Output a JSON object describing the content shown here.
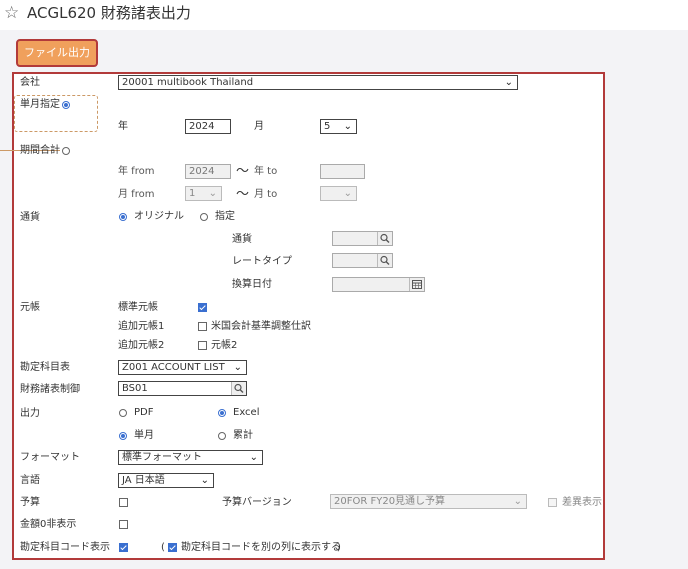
{
  "header": {
    "star_icon": "☆",
    "title": "ACGL620 財務諸表出力"
  },
  "toolbar": {
    "export_label": "ファイル出力"
  },
  "form": {
    "company_label": "会社",
    "company_value": "20001 multibook Thailand",
    "single_month_label": "単月指定",
    "year_label": "年",
    "year_value": "2024",
    "month_label": "月",
    "month_value": "5",
    "period_total_label": "期間合計",
    "year_from_label": "年 from",
    "year_from_value": "2024",
    "tilde": "～",
    "year_to_label": "年 to",
    "month_from_label": "月 from",
    "month_from_value": "1",
    "month_to_label": "月 to",
    "currency_label": "通貨",
    "currency_original": "オリジナル",
    "currency_specified": "指定",
    "currency_sub_label": "通貨",
    "rate_type_label": "レートタイプ",
    "conversion_date_label": "換算日付",
    "ledger_label": "元帳",
    "standard_ledger_label": "標準元帳",
    "additional_ledger1_label": "追加元帳1",
    "us_gaap_label": "米国会計基準調整仕訳",
    "additional_ledger2_label": "追加元帳2",
    "ledger2_label": "元帳2",
    "account_table_label": "勘定科目表",
    "account_table_value": "Z001 ACCOUNT LIST",
    "fs_control_label": "財務諸表制御",
    "fs_control_value": "BS01",
    "output_label": "出力",
    "pdf_label": "PDF",
    "excel_label": "Excel",
    "single_label": "単月",
    "cumulative_label": "累計",
    "format_label": "フォーマット",
    "format_value": "標準フォーマット",
    "language_label": "言語",
    "language_value": "JA 日本語",
    "budget_label": "予算",
    "budget_version_label": "予算バージョン",
    "budget_version_value": "20FOR FY20見通し予算",
    "variance_label": "差異表示",
    "zero_hide_label": "金額0非表示",
    "account_code_label": "勘定科目コード表示",
    "account_code_note_open": "(",
    "account_code_note": "勘定科目コードを別の列に表示する",
    "account_code_note_close": ")"
  },
  "colors": {
    "accent": "#3a6fd0",
    "button": "#f0a05c",
    "outline": "#b23a3a"
  }
}
